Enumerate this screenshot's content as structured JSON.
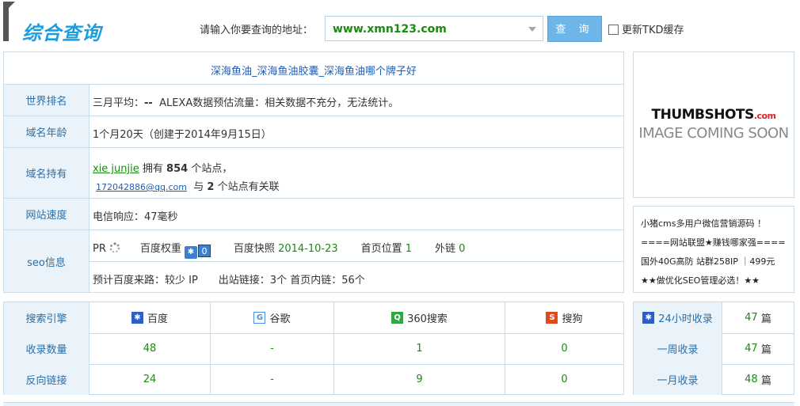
{
  "header": {
    "title": "综合查询",
    "address_label": "请输入你要查询的地址：",
    "address_value": "www.xmn123.com",
    "query_button": "查 询",
    "refresh_tkd_label": "更新TKD缓存"
  },
  "site_title": "深海鱼油_深海鱼油胶囊_深海鱼油哪个牌子好",
  "rows": {
    "world_rank": {
      "label": "世界排名",
      "avg_label": "三月平均：",
      "avg_value": "--",
      "alexa_text": "ALEXA数据预估流量：相关数据不充分，无法统计。"
    },
    "domain_age": {
      "label": "域名年龄",
      "value": "1个月20天（创建于2014年9月15日）"
    },
    "domain_owner": {
      "label": "域名持有",
      "owner": "xie junjie",
      "owns_prefix": "拥有",
      "owns_count": "854",
      "owns_suffix": "个站点，",
      "email": "172042886@qq.com",
      "related_prefix": "与",
      "related_count": "2",
      "related_suffix": "个站点有关联"
    },
    "speed": {
      "label": "网站速度",
      "value": "电信响应：47毫秒"
    },
    "seo": {
      "label": "seo信息",
      "pr_label": "PR",
      "baidu_weight_label": "百度权重",
      "baidu_weight_value": "0",
      "snapshot_label": "百度快照",
      "snapshot_value": "2014-10-23",
      "home_pos_label": "首页位置",
      "home_pos_value": "1",
      "external_label": "外链",
      "external_value": "0",
      "line2": "预计百度来路：较少 IP　　出站链接：3个 首页内链：56个"
    }
  },
  "thumb": {
    "line1": "THUMBSHOTS",
    "line1_suffix": ".com",
    "line2": "IMAGE COMING SOON"
  },
  "ad_lines": [
    "小猪cms多用户微信营销源码 ！",
    "====网站联盟★赚钱哪家强====",
    "国外40G高防 站群258IP ｜499元",
    "★★做优化SEO管理必选！★★"
  ],
  "engines": {
    "header_label": "搜索引擎",
    "names": [
      "百度",
      "谷歌",
      "360搜索",
      "搜狗"
    ],
    "icon_colors": [
      "#2b5fc7",
      "#4a8fdd",
      "#2fa843",
      "#e24a1c"
    ],
    "rows": [
      {
        "label": "收录数量",
        "values": [
          "48",
          "-",
          "1",
          "0"
        ]
      },
      {
        "label": "反向链接",
        "values": [
          "24",
          "-",
          "9",
          "0"
        ]
      }
    ]
  },
  "recent": [
    {
      "label": "24小时收录",
      "value": "47",
      "unit": "篇"
    },
    {
      "label": "一周收录",
      "value": "47",
      "unit": "篇"
    },
    {
      "label": "一月收录",
      "value": "48",
      "unit": "篇"
    }
  ]
}
